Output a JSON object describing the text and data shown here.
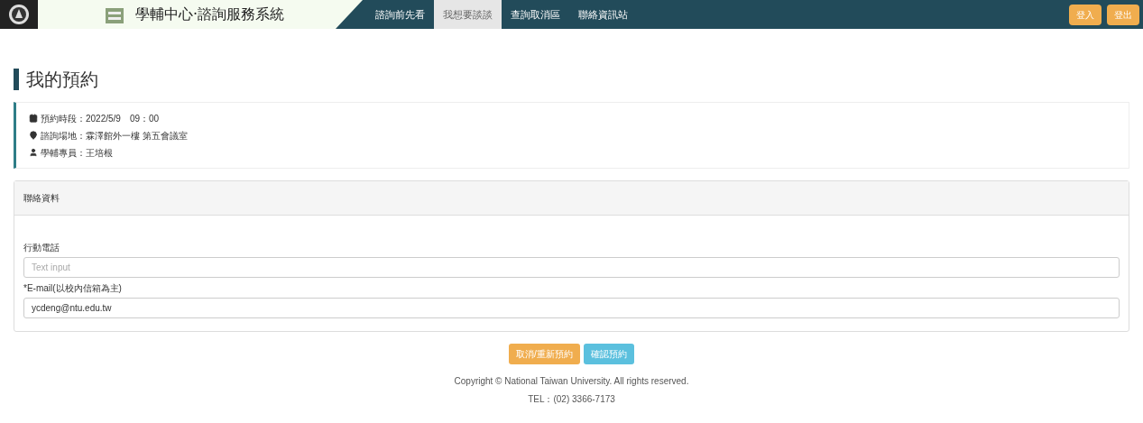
{
  "header": {
    "title": "學輔中心·諮詢服務系統",
    "nav": [
      {
        "label": "諮詢前先看",
        "selected": false
      },
      {
        "label": "我想要談談",
        "selected": true
      },
      {
        "label": "查詢取消區",
        "selected": false
      },
      {
        "label": "聯絡資訊站",
        "selected": false
      }
    ],
    "actions": [
      "登入",
      "登出"
    ]
  },
  "page_title": "我的預約",
  "summary": [
    {
      "kind": "calendar",
      "text": "預約時段：2022/5/9　09：00"
    },
    {
      "kind": "location",
      "text": "諮詢場地：霖澤館外一樓 第五會議室"
    },
    {
      "kind": "person",
      "text": "學輔專員：王培根"
    }
  ],
  "contact": {
    "heading": "聯絡資料",
    "fields": [
      {
        "label": "行動電話",
        "placeholder": "Text input"
      },
      {
        "label": "*E-mail(以校內信箱為主)",
        "value": "ycdeng@ntu.edu.tw"
      }
    ]
  },
  "buttons": [
    {
      "kind": "warning",
      "label": "取消/重新預約"
    },
    {
      "kind": "info",
      "label": "確認預約"
    }
  ],
  "footer": [
    "Copyright © National Taiwan University. All rights reserved.",
    "TEL：(02) 3366-7173"
  ]
}
